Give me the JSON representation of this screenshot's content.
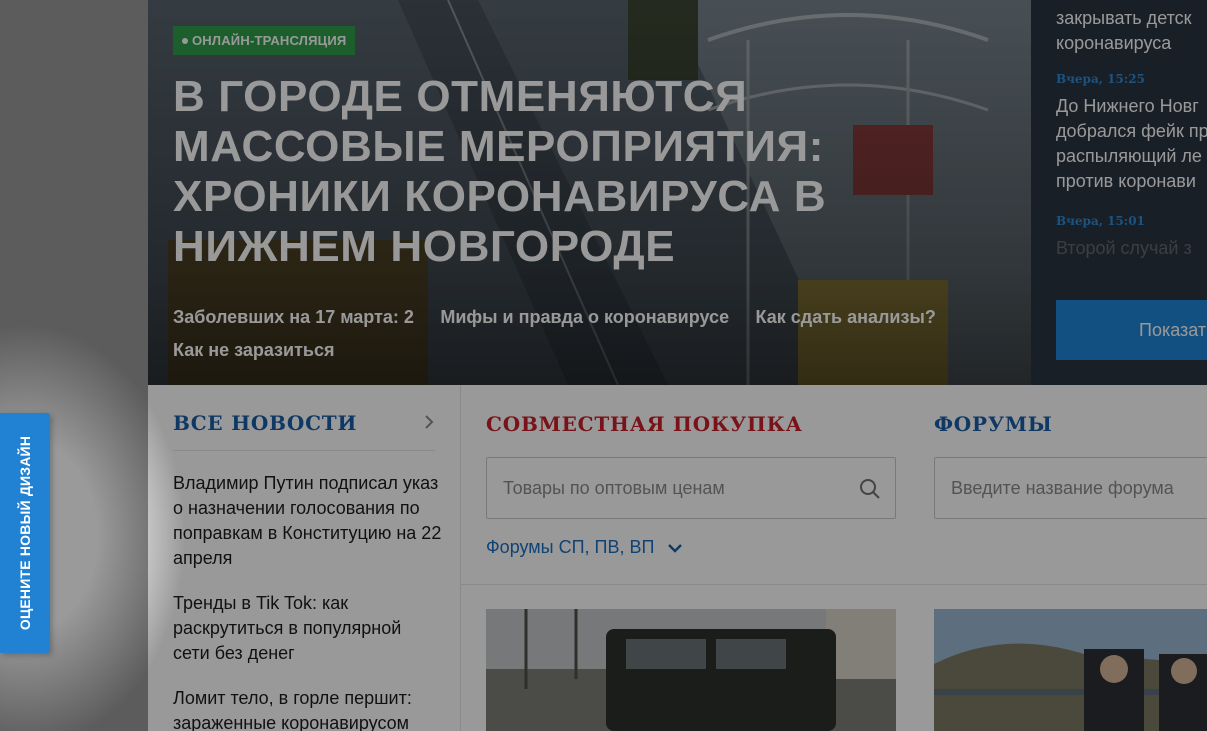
{
  "hero": {
    "badge": "ОНЛАЙН-ТРАНСЛЯЦИЯ",
    "title": "В ГОРОДЕ ОТМЕНЯЮТСЯ МАССОВЫЕ МЕРОПРИЯТИЯ: ХРОНИКИ КОРОНАВИРУСА В НИЖНЕМ НОВГОРОДЕ",
    "links": [
      "Заболевших на 17 марта: 2",
      "Мифы и правда о коронавирусе",
      "Как сдать анализы?",
      "Как не заразиться"
    ]
  },
  "feed": {
    "items": [
      {
        "time": "",
        "text": [
          "закрывать детск",
          "коронавируса"
        ]
      },
      {
        "time": "Вчера, 15:25",
        "text": [
          "До Нижнего Новг",
          "добрался фейк пр",
          "распыляющий ле",
          "против коронави"
        ]
      },
      {
        "time": "Вчера, 15:01",
        "text": [
          "Второй случай з"
        ]
      }
    ],
    "button": "Показат"
  },
  "news": {
    "title": "ВСЕ НОВОСТИ",
    "items": [
      "Владимир Путин подписал указ о назначении голосования по поправкам в Конституцию на 22 апреля",
      "Тренды в Tik Tok: как раскрутиться в популярной сети без денег",
      "Ломит тело, в горле першит: зараженные коронавирусом"
    ]
  },
  "purchase": {
    "title": "СОВМЕСТНАЯ ПОКУПКА",
    "search_placeholder": "Товары по оптовым ценам",
    "forums_link": "Форумы СП, ПВ, ВП"
  },
  "forums": {
    "title": "ФОРУМЫ",
    "search_placeholder": "Введите название форума"
  },
  "feedback_tab": {
    "label": "ОЦЕНИТЕ НОВЫЙ ДИЗАЙН"
  },
  "colors": {
    "accent": "#2182d4",
    "badge": "#2f9e4a",
    "purchase_title": "#c8202a",
    "section_title": "#1a5ea8"
  }
}
